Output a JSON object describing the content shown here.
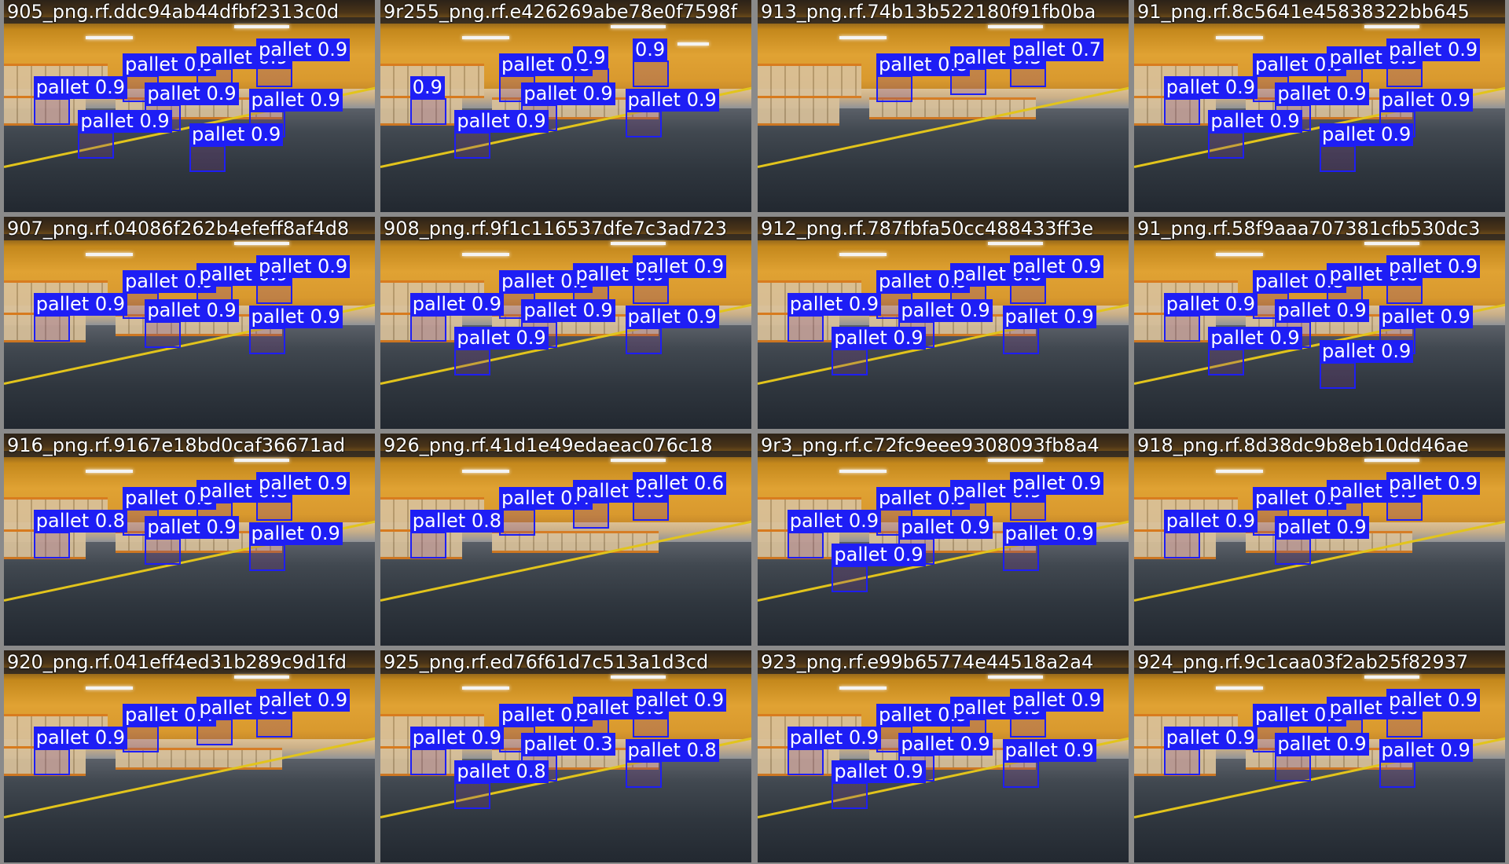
{
  "colors": {
    "box": "#1e1ef5",
    "label_text": "#ffffff",
    "title_text": "#ffffff",
    "gap": "#8a8a8a"
  },
  "tiles": [
    {
      "title": "905_png.rf.ddc94ab44dfbf2313c0d",
      "labels": [
        "pallet 0.9",
        "pallet 0.9",
        "pallet 0.9",
        "pallet 0.9",
        "pallet 0.9",
        "pallet 0.9",
        "pallet 0.9",
        "pallet 0.9"
      ]
    },
    {
      "title": "9r255_png.rf.e426269abe78e0f7598f",
      "labels": [
        "pallet 0.8",
        "0.9",
        "0.9",
        "0.9",
        "pallet 0.9",
        "pallet 0.9",
        "pallet 0.9"
      ]
    },
    {
      "title": "913_png.rf.74b13b522180f91fb0ba",
      "labels": [
        "pallet 0.8",
        "pallet 0.5",
        "pallet 0.7"
      ]
    },
    {
      "title": "91_png.rf.8c5641e45838322bb645",
      "labels": [
        "pallet 0.9",
        "pallet 0.9",
        "pallet 0.9",
        "pallet 0.9",
        "pallet 0.9",
        "pallet 0.9",
        "pallet 0.9",
        "pallet 0.9"
      ]
    },
    {
      "title": "907_png.rf.04086f262b4efeff8af4d8",
      "labels": [
        "pallet 0.9",
        "pallet 0.9",
        "pallet 0.9",
        "pallet 0.9",
        "pallet 0.9",
        "pallet 0.9"
      ]
    },
    {
      "title": "908_png.rf.9f1c116537dfe7c3ad723",
      "labels": [
        "pallet 0.9",
        "pallet 0.9",
        "pallet 0.9",
        "pallet 0.9",
        "pallet 0.9",
        "pallet 0.9",
        "pallet 0.9"
      ]
    },
    {
      "title": "912_png.rf.787fbfa50cc488433ff3e",
      "labels": [
        "pallet 0.9",
        "pallet 0.8",
        "pallet 0.9",
        "pallet 0.9",
        "pallet 0.9",
        "pallet 0.9",
        "pallet 0.9"
      ]
    },
    {
      "title": "91_png.rf.58f9aaa707381cfb530dc3",
      "labels": [
        "pallet 0.8",
        "pallet 0.8",
        "pallet 0.9",
        "pallet 0.9",
        "pallet 0.9",
        "pallet 0.9",
        "pallet 0.9",
        "pallet 0.9"
      ]
    },
    {
      "title": "916_png.rf.9167e18bd0caf36671ad",
      "labels": [
        "pallet 0.8",
        "pallet 0.8",
        "pallet 0.9",
        "pallet 0.8",
        "pallet 0.9",
        "pallet 0.9"
      ]
    },
    {
      "title": "926_png.rf.41d1e49edaeac076c18",
      "labels": [
        "pallet 0.4",
        "pallet 0.8",
        "pallet 0.6",
        "pallet 0.8"
      ]
    },
    {
      "title": "9r3_png.rf.c72fc9eee9308093fb8a4",
      "labels": [
        "pallet 0.9",
        "pallet 0.9",
        "pallet 0.9",
        "pallet 0.9",
        "pallet 0.9",
        "pallet 0.9",
        "pallet 0.9"
      ]
    },
    {
      "title": "918_png.rf.8d38dc9b8eb10dd46ae",
      "labels": [
        "pallet 0.8",
        "pallet 0.9",
        "pallet 0.9",
        "pallet 0.9",
        "pallet 0.9"
      ]
    },
    {
      "title": "920_png.rf.041eff4ed31b289c9d1fd",
      "labels": [
        "pallet 0.4",
        "pallet 0.8",
        "pallet 0.9",
        "pallet 0.9"
      ]
    },
    {
      "title": "925_png.rf.ed76f61d7c513a1d3cd",
      "labels": [
        "pallet 0.5",
        "pallet 0.8",
        "pallet 0.9",
        "pallet 0.9",
        "pallet 0.3",
        "pallet 0.8",
        "pallet 0.8"
      ]
    },
    {
      "title": "923_png.rf.e99b65774e44518a2a4",
      "labels": [
        "pallet 0.9",
        "pallet 0.9",
        "pallet 0.9",
        "pallet 0.9",
        "pallet 0.9",
        "pallet 0.9",
        "pallet 0.9"
      ]
    },
    {
      "title": "924_png.rf.9c1caa03f2ab25f82937",
      "labels": [
        "pallet 0.8",
        "pallet 0.8",
        "pallet 0.9",
        "pallet 0.9",
        "pallet 0.9",
        "pallet 0.9"
      ]
    }
  ]
}
